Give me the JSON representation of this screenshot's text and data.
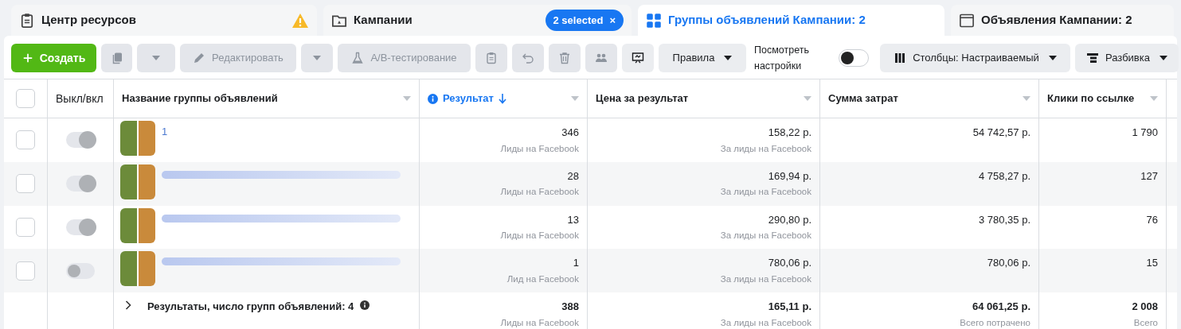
{
  "tabs": [
    {
      "label": "Центр ресурсов",
      "selected": false,
      "warning": true
    },
    {
      "label": "Кампании",
      "selected": false,
      "badge": "2 selected",
      "badge_close": "×"
    },
    {
      "label": "Группы объявлений Кампании: 2",
      "selected": true
    },
    {
      "label": "Объявления Кампании: 2",
      "selected": false
    }
  ],
  "toolbar": [
    {
      "kind": "primary",
      "label": "Создать"
    },
    {
      "kind": "icon",
      "disabled": true
    },
    {
      "kind": "caret",
      "disabled": true
    },
    {
      "kind": "text",
      "label": "Редактировать",
      "disabled": true
    },
    {
      "kind": "caret",
      "disabled": true
    },
    {
      "kind": "text",
      "label": "A/B-тестирование",
      "disabled": true
    },
    {
      "kind": "icon",
      "disabled": true
    },
    {
      "kind": "icon",
      "disabled": true
    },
    {
      "kind": "icon",
      "disabled": true
    },
    {
      "kind": "icon",
      "disabled": true
    },
    {
      "kind": "icon",
      "disabled": false
    },
    {
      "kind": "dropdown",
      "label": "Правила",
      "disabled": false
    },
    {
      "kind": "switch",
      "label": "Посмотреть настройки",
      "on": false
    },
    {
      "kind": "dropdown",
      "label": "Столбцы: Настраиваемый",
      "disabled": false
    },
    {
      "kind": "dropdown",
      "label": "Разбивка",
      "disabled": false
    }
  ],
  "table": {
    "header_checked": false,
    "columns": [
      {
        "label": "Выкл/вкл",
        "sorted": false,
        "info": false,
        "menu": false
      },
      {
        "label": "Название группы объявлений",
        "sorted": false,
        "info": false,
        "menu": true
      },
      {
        "label": "Результат",
        "sorted": true,
        "info": true,
        "menu": true
      },
      {
        "label": "Цена за результат",
        "sorted": false,
        "info": false,
        "menu": true
      },
      {
        "label": "Сумма затрат",
        "sorted": false,
        "info": false,
        "menu": true
      },
      {
        "label": "Клики по ссылке",
        "sorted": false,
        "info": false,
        "menu": true
      }
    ],
    "rows": [
      {
        "checked": false,
        "on": true,
        "name": "1",
        "result": "346",
        "result_sub": "Лиды на Facebook",
        "price": "158,22 р.",
        "price_sub": "За лиды на Facebook",
        "spend": "54 742,57 р.",
        "clicks": "1 790"
      },
      {
        "checked": false,
        "on": true,
        "result": "28",
        "result_sub": "Лиды на Facebook",
        "price": "169,94 р.",
        "price_sub": "За лиды на Facebook",
        "spend": "4 758,27 р.",
        "clicks": "127"
      },
      {
        "checked": false,
        "on": true,
        "result": "13",
        "result_sub": "Лиды на Facebook",
        "price": "290,80 р.",
        "price_sub": "За лиды на Facebook",
        "spend": "3 780,35 р.",
        "clicks": "76"
      },
      {
        "checked": false,
        "on": false,
        "result": "1",
        "result_sub": "Лид на Facebook",
        "price": "780,06 р.",
        "price_sub": "За лиды на Facebook",
        "spend": "780,06 р.",
        "clicks": "15"
      }
    ],
    "totals": {
      "label": "Результаты, число групп объявлений: 4",
      "result": "388",
      "result_sub": "Лиды на Facebook",
      "price": "165,11 р.",
      "price_sub": "За лиды на Facebook",
      "spend": "64 061,25 р.",
      "spend_sub": "Всего потрачено",
      "clicks": "2 008",
      "clicks_sub": "Всего"
    }
  }
}
